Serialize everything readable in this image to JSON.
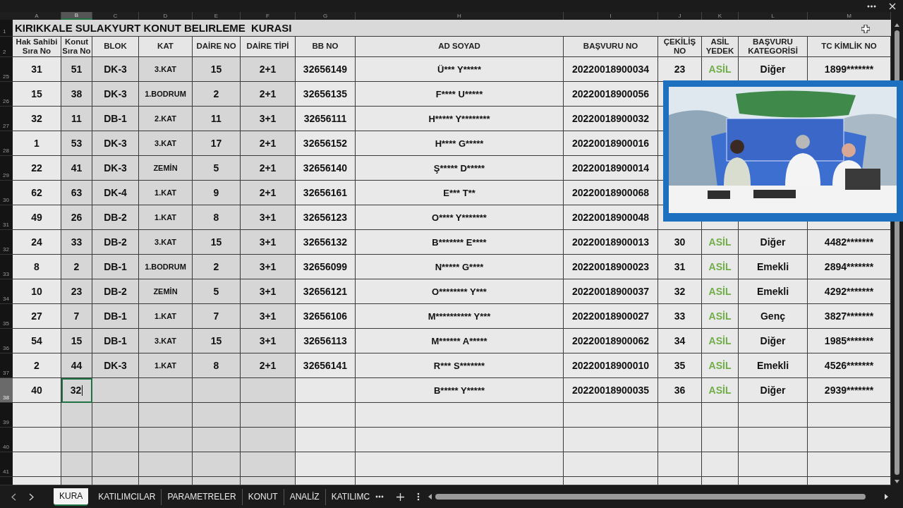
{
  "sheet": {
    "title_row_number": "1",
    "title": "KIRIKKALE SULAKYURT KONUT BELIRLEME  KURASI",
    "header_row_number": "2",
    "columns": [
      {
        "letter": "A",
        "selected": false
      },
      {
        "letter": "B",
        "selected": true
      },
      {
        "letter": "C",
        "selected": false
      },
      {
        "letter": "D",
        "selected": false
      },
      {
        "letter": "E",
        "selected": false
      },
      {
        "letter": "F",
        "selected": false
      },
      {
        "letter": "G",
        "selected": false
      },
      {
        "letter": "H",
        "selected": false
      },
      {
        "letter": "I",
        "selected": false
      },
      {
        "letter": "J",
        "selected": false
      },
      {
        "letter": "K",
        "selected": false
      },
      {
        "letter": "L",
        "selected": false
      },
      {
        "letter": "M",
        "selected": false
      }
    ],
    "headers": [
      "Hak Sahibi Sıra No",
      "Konut Sıra No",
      "BLOK",
      "KAT",
      "DAİRE NO",
      "DAİRE TİPİ",
      "BB NO",
      "AD SOYAD",
      "BAŞVURU NO",
      "ÇEKİLİŞ NO",
      "ASİL YEDEK",
      "BAŞVURU KATEGORİSİ",
      "TC KİMLİK NO"
    ],
    "rows": [
      {
        "number": "25",
        "selected": false,
        "cells": [
          "31",
          "51",
          "DK-3",
          "3.KAT",
          "15",
          "2+1",
          "32656149",
          "Ü*** Y*****",
          "20220018900034",
          "23",
          "ASİL",
          "Diğer",
          "1899*******"
        ]
      },
      {
        "number": "26",
        "selected": false,
        "cells": [
          "15",
          "38",
          "DK-3",
          "1.BODRUM",
          "2",
          "2+1",
          "32656135",
          "F**** U*****",
          "20220018900056"
        ]
      },
      {
        "number": "27",
        "selected": false,
        "cells": [
          "32",
          "11",
          "DB-1",
          "2.KAT",
          "11",
          "3+1",
          "32656111",
          "H***** Y********",
          "20220018900032"
        ]
      },
      {
        "number": "28",
        "selected": false,
        "cells": [
          "1",
          "53",
          "DK-3",
          "3.KAT",
          "17",
          "2+1",
          "32656152",
          "H**** G*****",
          "20220018900016"
        ]
      },
      {
        "number": "29",
        "selected": false,
        "cells": [
          "22",
          "41",
          "DK-3",
          "ZEMİN",
          "5",
          "2+1",
          "32656140",
          "Ş***** D*****",
          "20220018900014"
        ]
      },
      {
        "number": "30",
        "selected": false,
        "cells": [
          "62",
          "63",
          "DK-4",
          "1.KAT",
          "9",
          "2+1",
          "32656161",
          "E*** T**",
          "20220018900068"
        ]
      },
      {
        "number": "31",
        "selected": false,
        "cells": [
          "49",
          "26",
          "DB-2",
          "1.KAT",
          "8",
          "3+1",
          "32656123",
          "O**** Y*******",
          "20220018900048"
        ]
      },
      {
        "number": "32",
        "selected": false,
        "cells": [
          "24",
          "33",
          "DB-2",
          "3.KAT",
          "15",
          "3+1",
          "32656132",
          "B******* E****",
          "20220018900013",
          "30",
          "ASİL",
          "Diğer",
          "4482*******"
        ]
      },
      {
        "number": "33",
        "selected": false,
        "cells": [
          "8",
          "2",
          "DB-1",
          "1.BODRUM",
          "2",
          "3+1",
          "32656099",
          "N***** G****",
          "20220018900023",
          "31",
          "ASİL",
          "Emekli",
          "2894*******"
        ]
      },
      {
        "number": "34",
        "selected": false,
        "cells": [
          "10",
          "23",
          "DB-2",
          "ZEMİN",
          "5",
          "3+1",
          "32656121",
          "O******** Y***",
          "20220018900037",
          "32",
          "ASİL",
          "Emekli",
          "4292*******"
        ]
      },
      {
        "number": "35",
        "selected": false,
        "cells": [
          "27",
          "7",
          "DB-1",
          "1.KAT",
          "7",
          "3+1",
          "32656106",
          "M********** Y***",
          "20220018900027",
          "33",
          "ASİL",
          "Genç",
          "3827*******"
        ]
      },
      {
        "number": "36",
        "selected": false,
        "cells": [
          "54",
          "15",
          "DB-1",
          "3.KAT",
          "15",
          "3+1",
          "32656113",
          "M****** A*****",
          "20220018900062",
          "34",
          "ASİL",
          "Diğer",
          "1985*******"
        ]
      },
      {
        "number": "37",
        "selected": false,
        "cells": [
          "2",
          "44",
          "DK-3",
          "1.KAT",
          "8",
          "2+1",
          "32656141",
          "R*** S*******",
          "20220018900010",
          "35",
          "ASİL",
          "Emekli",
          "4526*******"
        ]
      },
      {
        "number": "38",
        "selected": true,
        "cells": [
          "40",
          "32",
          null,
          null,
          null,
          null,
          null,
          "B***** Y*****",
          "20220018900035",
          "36",
          "ASİL",
          "Diğer",
          "2939*******"
        ]
      },
      {
        "number": "39",
        "selected": false,
        "cells": []
      },
      {
        "number": "40",
        "selected": false,
        "cells": []
      },
      {
        "number": "41",
        "selected": false,
        "cells": []
      }
    ]
  },
  "tabs": [
    {
      "label": "KURA",
      "selected": true
    },
    {
      "label": "KATILIMCILAR",
      "selected": false
    },
    {
      "label": "PARAMETRELER",
      "selected": false
    },
    {
      "label": "KONUT",
      "selected": false
    },
    {
      "label": "ANALİZ",
      "selected": false
    },
    {
      "label": "KATILIMC",
      "selected": false
    }
  ]
}
